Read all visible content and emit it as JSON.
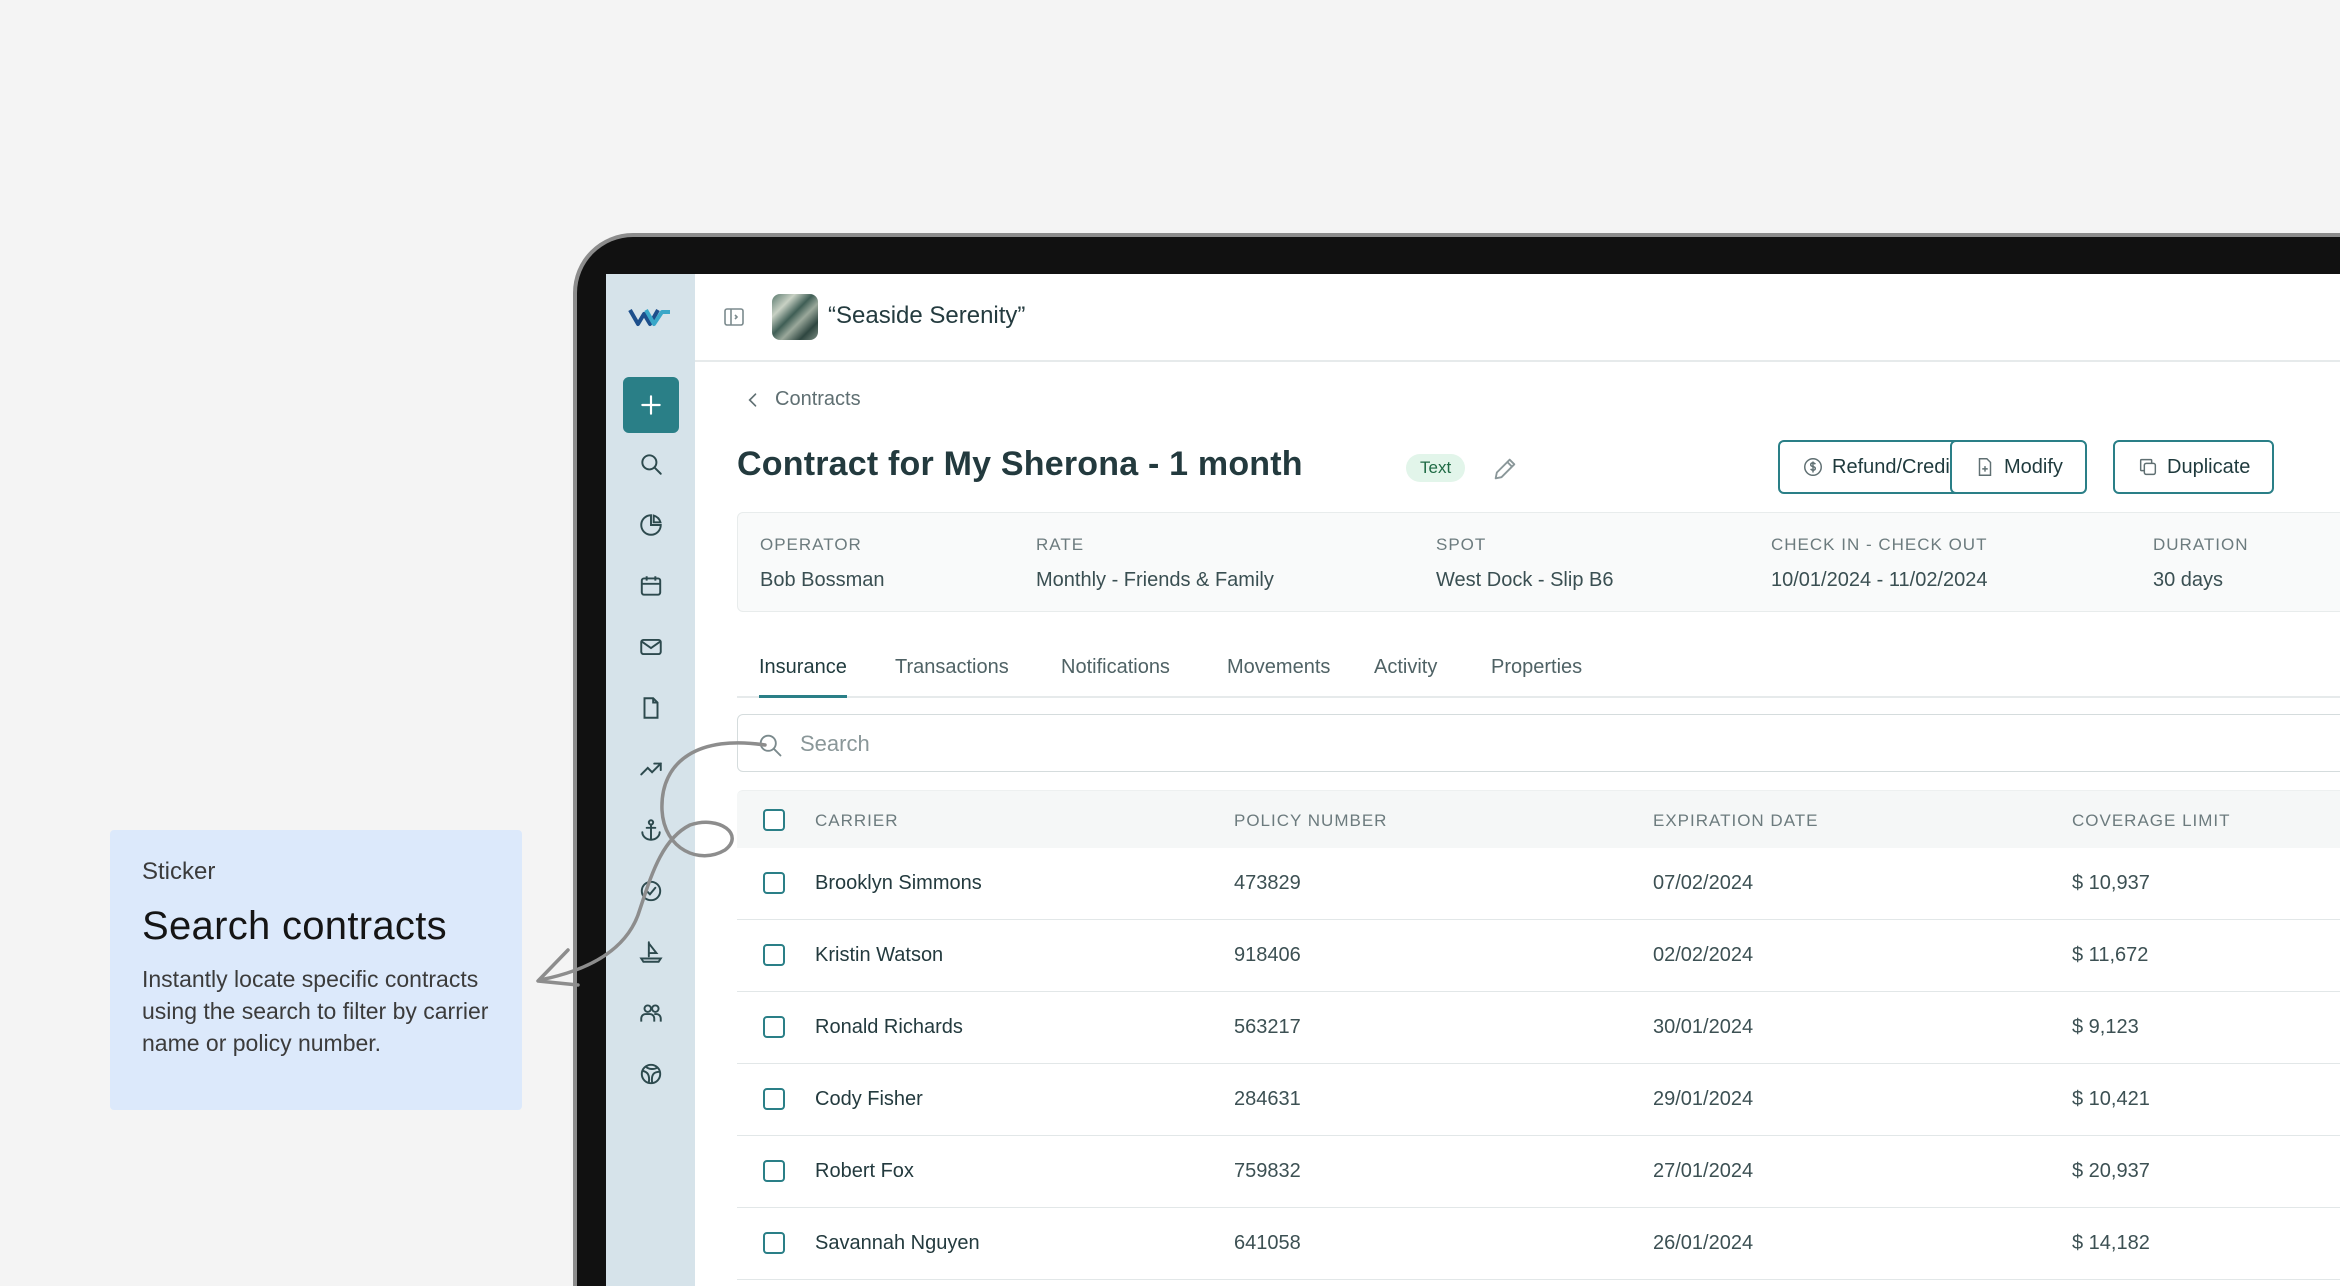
{
  "app": {
    "boat_name": "“Seaside Serenity”"
  },
  "breadcrumb": {
    "label": "Contracts"
  },
  "contract": {
    "title": "Contract for My Sherona - 1 month",
    "tag": "Text"
  },
  "actions": {
    "refund_label": "Refund/Credits",
    "modify_label": "Modify",
    "duplicate_label": "Duplicate"
  },
  "info": [
    {
      "label": "OPERATOR",
      "value": "Bob Bossman"
    },
    {
      "label": "RATE",
      "value": "Monthly - Friends & Family"
    },
    {
      "label": "SPOT",
      "value": "West Dock - Slip B6"
    },
    {
      "label": "CHECK IN - CHECK OUT",
      "value": "10/01/2024 - 11/02/2024"
    },
    {
      "label": "DURATION",
      "value": "30 days"
    }
  ],
  "tabs": [
    {
      "label": "Insurance",
      "active": true
    },
    {
      "label": "Transactions"
    },
    {
      "label": "Notifications"
    },
    {
      "label": "Movements"
    },
    {
      "label": "Activity"
    },
    {
      "label": "Properties"
    }
  ],
  "search": {
    "placeholder": "Search"
  },
  "table": {
    "columns": [
      "CARRIER",
      "POLICY NUMBER",
      "EXPIRATION DATE",
      "COVERAGE LIMIT"
    ],
    "rows": [
      {
        "carrier": "Brooklyn Simmons",
        "policy": "473829",
        "expiration": "07/02/2024",
        "limit": "$ 10,937"
      },
      {
        "carrier": "Kristin Watson",
        "policy": "918406",
        "expiration": "02/02/2024",
        "limit": "$ 11,672"
      },
      {
        "carrier": "Ronald Richards",
        "policy": "563217",
        "expiration": "30/01/2024",
        "limit": "$ 9,123"
      },
      {
        "carrier": "Cody Fisher",
        "policy": "284631",
        "expiration": "29/01/2024",
        "limit": "$ 10,421"
      },
      {
        "carrier": "Robert Fox",
        "policy": "759832",
        "expiration": "27/01/2024",
        "limit": "$ 20,937"
      },
      {
        "carrier": "Savannah Nguyen",
        "policy": "641058",
        "expiration": "26/01/2024",
        "limit": "$ 14,182"
      }
    ]
  },
  "sticker": {
    "kicker": "Sticker",
    "title": "Search contracts",
    "description": "Instantly locate specific contracts using the search to filter by carrier name or policy number."
  },
  "colors": {
    "accent": "#2a7f87",
    "sidebar": "#d6e3ea",
    "sticker_bg": "#dce9fb",
    "tag_bg": "#e2f5ea"
  },
  "icons": {
    "sidebar": [
      "add-icon",
      "search-icon",
      "pie-chart-icon",
      "calendar-icon",
      "mail-icon",
      "document-icon",
      "trend-icon",
      "anchor-icon",
      "check-circle-icon",
      "boat-icon",
      "users-icon",
      "globe-icon"
    ]
  }
}
